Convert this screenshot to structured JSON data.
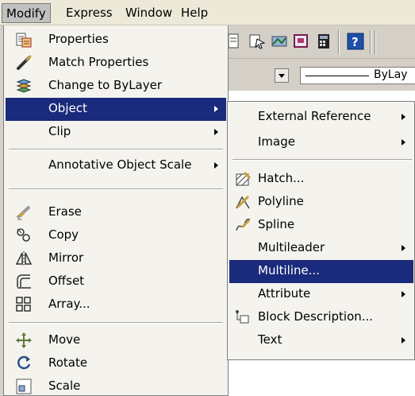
{
  "menubar": {
    "items": [
      {
        "label": "Modify"
      },
      {
        "label": "Express"
      },
      {
        "label": "Window"
      },
      {
        "label": "Help"
      }
    ]
  },
  "propbar": {
    "linetype_label": "ByLay"
  },
  "modify_menu": {
    "items": [
      {
        "label": "Properties",
        "icon": "properties-icon"
      },
      {
        "label": "Match Properties",
        "icon": "match-properties-icon"
      },
      {
        "label": "Change to ByLayer",
        "icon": "change-bylayer-icon"
      },
      {
        "label": "Object",
        "submenu": true,
        "highlighted": true
      },
      {
        "label": "Clip",
        "submenu": true
      },
      {
        "label": "Annotative Object Scale",
        "submenu": true
      },
      {
        "label": "Erase",
        "icon": "erase-icon"
      },
      {
        "label": "Copy",
        "icon": "copy-icon"
      },
      {
        "label": "Mirror",
        "icon": "mirror-icon"
      },
      {
        "label": "Offset",
        "icon": "offset-icon"
      },
      {
        "label": "Array...",
        "icon": "array-icon"
      },
      {
        "label": "Move",
        "icon": "move-icon"
      },
      {
        "label": "Rotate",
        "icon": "rotate-icon"
      },
      {
        "label": "Scale",
        "icon": "scale-icon"
      }
    ]
  },
  "object_submenu": {
    "items": [
      {
        "label": "External Reference",
        "submenu": true
      },
      {
        "label": "Image",
        "submenu": true
      },
      {
        "label": "Hatch...",
        "icon": "hatch-icon"
      },
      {
        "label": "Polyline",
        "icon": "polyline-icon"
      },
      {
        "label": "Spline",
        "icon": "spline-icon"
      },
      {
        "label": "Multileader",
        "submenu": true
      },
      {
        "label": "Multiline...",
        "highlighted": true
      },
      {
        "label": "Attribute",
        "submenu": true
      },
      {
        "label": "Block Description...",
        "icon": "block-description-icon"
      },
      {
        "label": "Text",
        "submenu": true
      }
    ]
  },
  "colors": {
    "highlight": "#1a2a7c",
    "menu_bg": "#f4f3ee",
    "menubar_bg": "#ece9d8"
  }
}
